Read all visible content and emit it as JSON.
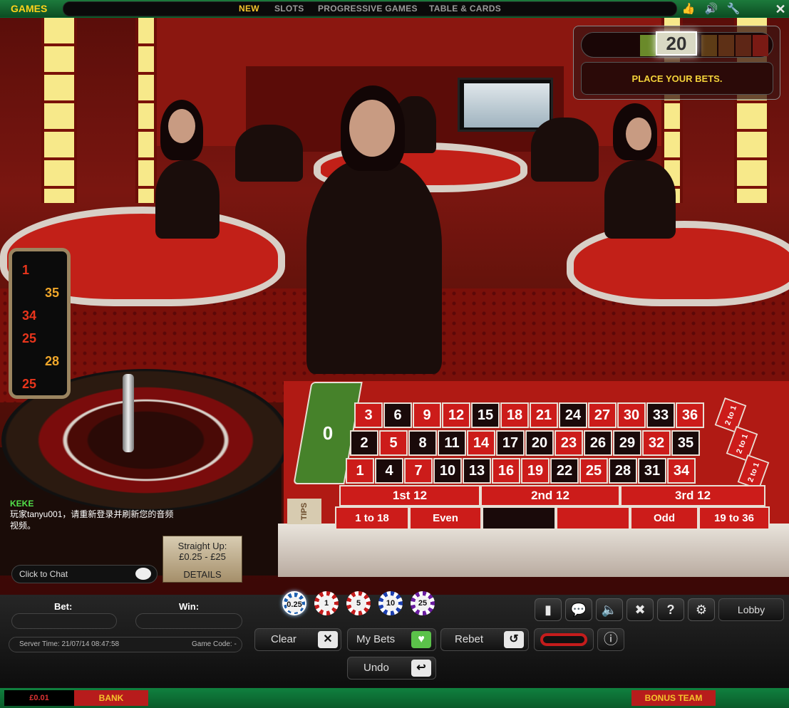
{
  "topbar": {
    "brand": "GAMES",
    "nav": [
      "NEW",
      "SLOTS",
      "PROGRESSIVE GAMES",
      "TABLE & CARDS"
    ],
    "active_nav": "NEW",
    "icons": [
      "thumbs-up-icon",
      "speaker-icon",
      "wrench-icon",
      "close-icon"
    ]
  },
  "timer": {
    "value": "20",
    "message": "PLACE YOUR BETS."
  },
  "history": [
    "1",
    "35",
    "34",
    "25",
    "28",
    "25"
  ],
  "layout": {
    "zero": "0",
    "rows": [
      [
        {
          "n": "3",
          "c": "red"
        },
        {
          "n": "6",
          "c": "black"
        },
        {
          "n": "9",
          "c": "red"
        },
        {
          "n": "12",
          "c": "red"
        },
        {
          "n": "15",
          "c": "black"
        },
        {
          "n": "18",
          "c": "red"
        },
        {
          "n": "21",
          "c": "red"
        },
        {
          "n": "24",
          "c": "black"
        },
        {
          "n": "27",
          "c": "red"
        },
        {
          "n": "30",
          "c": "red"
        },
        {
          "n": "33",
          "c": "black"
        },
        {
          "n": "36",
          "c": "red"
        }
      ],
      [
        {
          "n": "2",
          "c": "black"
        },
        {
          "n": "5",
          "c": "red"
        },
        {
          "n": "8",
          "c": "black"
        },
        {
          "n": "11",
          "c": "black"
        },
        {
          "n": "14",
          "c": "red"
        },
        {
          "n": "17",
          "c": "black"
        },
        {
          "n": "20",
          "c": "black"
        },
        {
          "n": "23",
          "c": "red"
        },
        {
          "n": "26",
          "c": "black"
        },
        {
          "n": "29",
          "c": "black"
        },
        {
          "n": "32",
          "c": "red"
        },
        {
          "n": "35",
          "c": "black"
        }
      ],
      [
        {
          "n": "1",
          "c": "red"
        },
        {
          "n": "4",
          "c": "black"
        },
        {
          "n": "7",
          "c": "red"
        },
        {
          "n": "10",
          "c": "black"
        },
        {
          "n": "13",
          "c": "black"
        },
        {
          "n": "16",
          "c": "red"
        },
        {
          "n": "19",
          "c": "red"
        },
        {
          "n": "22",
          "c": "black"
        },
        {
          "n": "25",
          "c": "red"
        },
        {
          "n": "28",
          "c": "black"
        },
        {
          "n": "31",
          "c": "black"
        },
        {
          "n": "34",
          "c": "red"
        }
      ]
    ],
    "column_bets": [
      "2 to 1",
      "2 to 1",
      "2 to 1"
    ],
    "dozens": [
      "1st 12",
      "2nd 12",
      "3rd 12"
    ],
    "outside": [
      "1 to 18",
      "Even",
      "",
      "",
      "Odd",
      "19 to 36"
    ],
    "tips": "TIPS"
  },
  "chat": {
    "username": "KEKE",
    "message": "玩家tanyu001，请重新登录并刷新您的音频视频。",
    "placeholder": "Click to Chat"
  },
  "limits": {
    "title": "Straight Up:",
    "range": "£0.25 - £25",
    "details": "DETAILS"
  },
  "bet_panel": {
    "bet_label": "Bet:",
    "win_label": "Win:",
    "server_time": "Server Time: 21/07/14 08:47:58",
    "game_code": "Game Code: -"
  },
  "chips": [
    "0.25",
    "1",
    "5",
    "10",
    "25"
  ],
  "buttons": {
    "clear": "Clear",
    "my_bets": "My Bets",
    "rebet": "Rebet",
    "undo": "Undo",
    "lobby": "Lobby"
  },
  "footer": {
    "balance": "£0.01",
    "bank": "BANK",
    "bonus": "BONUS TEAM"
  },
  "colors": {
    "accent_green": "#1c7a3c",
    "gold": "#f5c42c",
    "roulette_red": "#cc1c1a",
    "zero_green": "#46822a"
  }
}
